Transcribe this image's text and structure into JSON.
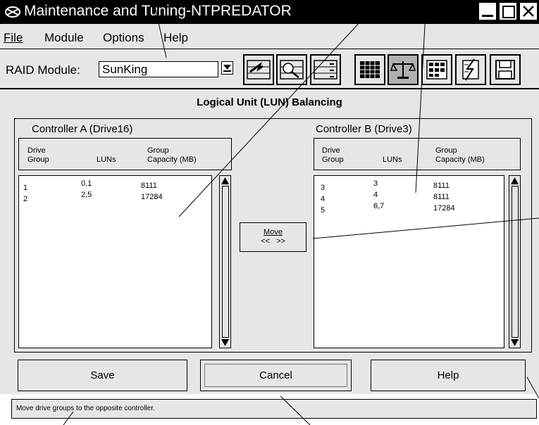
{
  "window": {
    "title": "Maintenance and Tuning-NTPREDATOR",
    "icons": [
      "app-icon",
      "minimize-icon",
      "maximize-icon",
      "close-icon"
    ]
  },
  "menu": {
    "items": [
      {
        "label": "File"
      },
      {
        "label": "Module"
      },
      {
        "label": "Options"
      },
      {
        "label": "Help"
      }
    ]
  },
  "toolbar": {
    "raid_label": "RAID Module:",
    "raid_value": "SunKing",
    "buttons": [
      "configuration-icon",
      "status-icon",
      "recovery-icon",
      "maintenance-icon",
      "lun-balancing-icon",
      "controller-mode-icon",
      "caching-icon",
      "save-module-icon"
    ]
  },
  "main": {
    "heading": "Logical Unit (LUN) Balancing",
    "controller_a": {
      "title": "Controller A (Drive16)",
      "headers": {
        "col1": "Drive\nGroup",
        "col2": "LUNs",
        "col3": "Group\nCapacity (MB)"
      },
      "rows": [
        {
          "group": "1",
          "luns": "0,1",
          "capacity": "8111"
        },
        {
          "group": "2",
          "luns": "2,5",
          "capacity": "17284"
        }
      ]
    },
    "controller_b": {
      "title": "Controller B (Drive3)",
      "headers": {
        "col1": "Drive\nGroup",
        "col2": "LUNs",
        "col3": "Group\nCapacity (MB)"
      },
      "rows": [
        {
          "group": "3",
          "luns": "3",
          "capacity": "8111"
        },
        {
          "group": "4",
          "luns": "4",
          "capacity": "8111"
        },
        {
          "group": "5",
          "luns": "6,7",
          "capacity": "17284"
        }
      ]
    },
    "move": {
      "label": "Move",
      "arrows": "<<   >>"
    },
    "buttons": {
      "save": "Save",
      "cancel": "Cancel",
      "help": "Help"
    }
  },
  "status": {
    "text": "Move drive groups to the opposite controller."
  }
}
